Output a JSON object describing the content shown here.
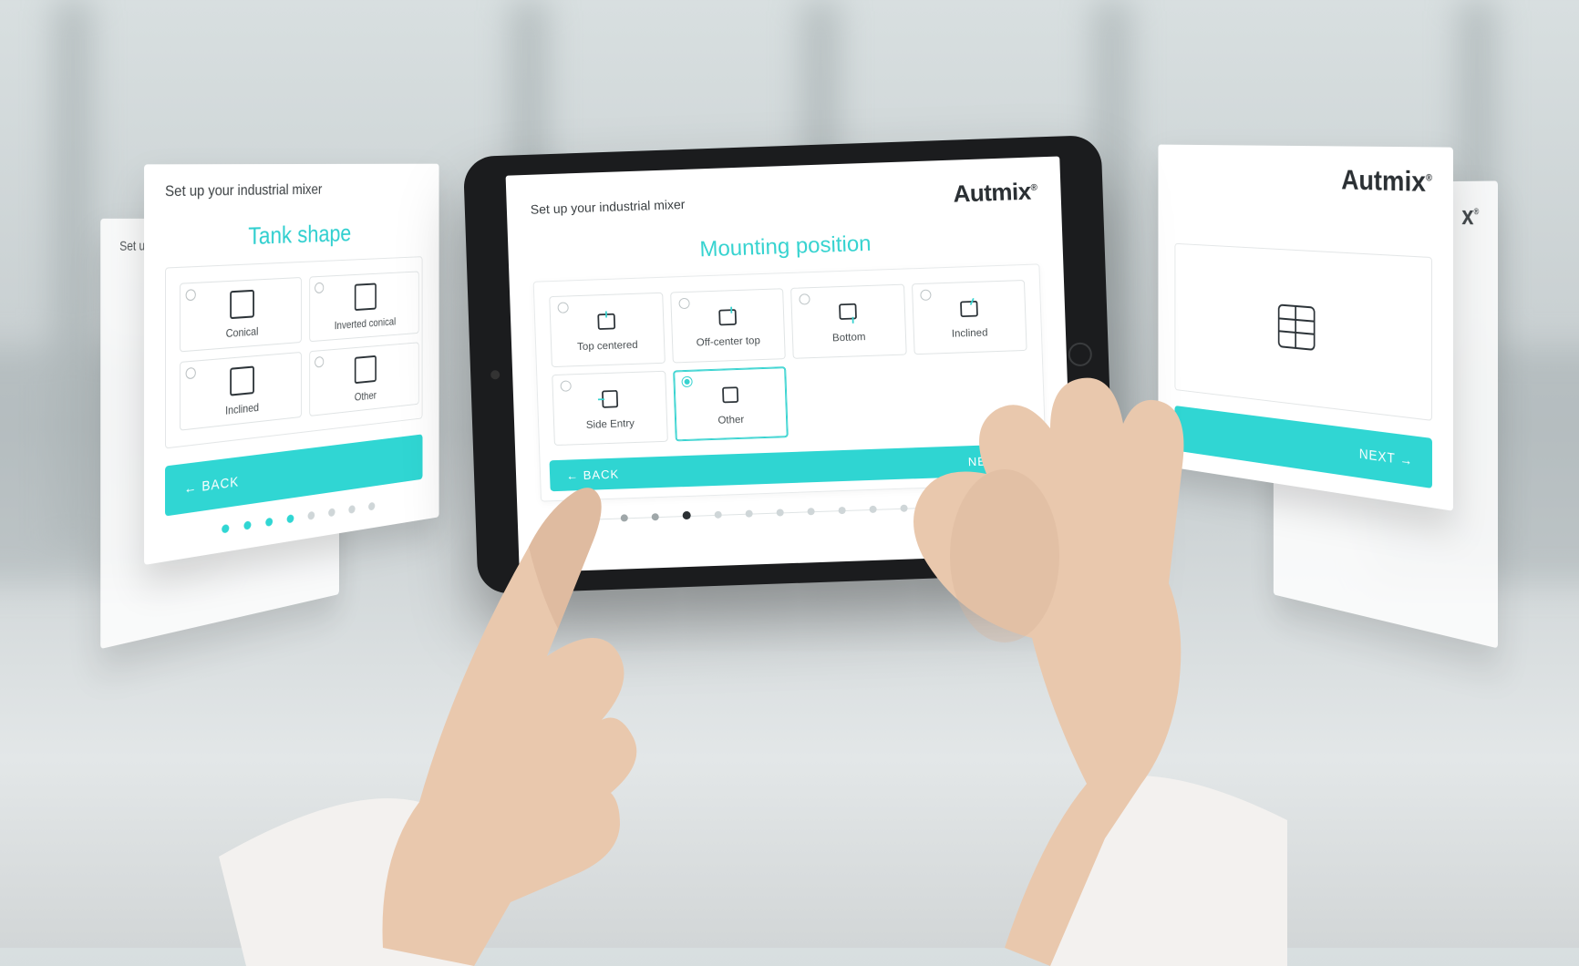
{
  "brand": "Autmix",
  "header": {
    "setup_label": "Set up your industrial mixer"
  },
  "main": {
    "section_title": "Mounting position",
    "options": [
      {
        "label": "Top centered"
      },
      {
        "label": "Off-center top"
      },
      {
        "label": "Bottom"
      },
      {
        "label": "Inclined"
      },
      {
        "label": "Side Entry"
      },
      {
        "label": "Other"
      }
    ],
    "selected_index": 5,
    "back_label": "BACK",
    "next_label": "NEXT",
    "step_count": 14,
    "current_step": 4
  },
  "left_panel": {
    "section_title": "Tank shape",
    "options": [
      {
        "label": "Conical"
      },
      {
        "label": "Inverted conical"
      },
      {
        "label": "Inclined"
      },
      {
        "label": "Other"
      }
    ],
    "back_label": "BACK"
  },
  "right_panel": {
    "next_label": "NEXT"
  },
  "far_left": {
    "setup_label": "Set u"
  }
}
